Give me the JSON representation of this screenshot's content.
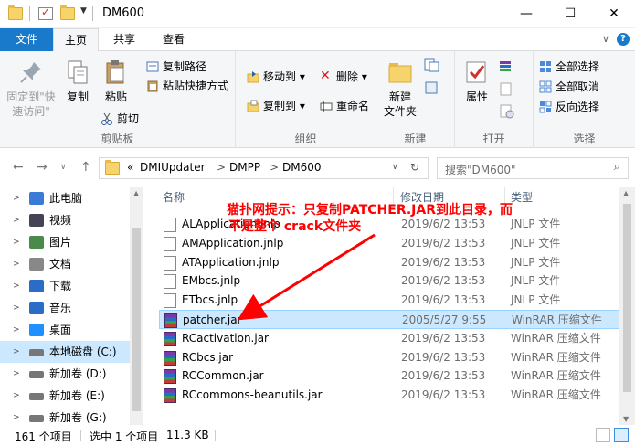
{
  "window": {
    "title": "DM600",
    "minimize": "—",
    "maximize": "☐",
    "close": "✕"
  },
  "tabs": {
    "file": "文件",
    "home": "主页",
    "share": "共享",
    "view": "查看",
    "collapse": "∨",
    "help": "?"
  },
  "ribbon": {
    "clipboard": {
      "label": "剪贴板",
      "pin": "固定到\"快速访问\"",
      "copy": "复制",
      "paste": "粘贴",
      "copy_path": "复制路径",
      "paste_shortcut": "粘贴快捷方式",
      "cut": "剪切"
    },
    "organize": {
      "label": "组织",
      "move_to": "移动到",
      "copy_to": "复制到",
      "delete": "删除",
      "rename": "重命名"
    },
    "new": {
      "label": "新建",
      "new_folder": "新建\n文件夹"
    },
    "open": {
      "label": "打开",
      "properties": "属性"
    },
    "select": {
      "label": "选择",
      "select_all": "全部选择",
      "select_none": "全部取消",
      "invert": "反向选择"
    }
  },
  "address": {
    "prefix": "«",
    "path": [
      "DMIUpdater",
      "DMPP",
      "DM600"
    ],
    "search_placeholder": "搜索\"DM600\""
  },
  "nav": {
    "items": [
      {
        "label": "此电脑",
        "icon": "computer-icon"
      },
      {
        "label": "视频",
        "icon": "video-icon"
      },
      {
        "label": "图片",
        "icon": "pictures-icon"
      },
      {
        "label": "文档",
        "icon": "documents-icon"
      },
      {
        "label": "下载",
        "icon": "download-icon"
      },
      {
        "label": "音乐",
        "icon": "music-icon"
      },
      {
        "label": "桌面",
        "icon": "desktop-icon"
      },
      {
        "label": "本地磁盘 (C:)",
        "icon": "drive-icon"
      },
      {
        "label": "新加卷 (D:)",
        "icon": "drive-icon"
      },
      {
        "label": "新加卷 (E:)",
        "icon": "drive-icon"
      },
      {
        "label": "新加卷 (G:)",
        "icon": "drive-icon"
      }
    ]
  },
  "columns": {
    "name": "名称",
    "date": "修改日期",
    "type": "类型"
  },
  "files": [
    {
      "name": "ALApplication.jnlp",
      "date": "2019/6/2 13:53",
      "type": "JNLP 文件",
      "kind": "doc"
    },
    {
      "name": "AMApplication.jnlp",
      "date": "2019/6/2 13:53",
      "type": "JNLP 文件",
      "kind": "doc"
    },
    {
      "name": "ATApplication.jnlp",
      "date": "2019/6/2 13:53",
      "type": "JNLP 文件",
      "kind": "doc"
    },
    {
      "name": "EMbcs.jnlp",
      "date": "2019/6/2 13:53",
      "type": "JNLP 文件",
      "kind": "doc"
    },
    {
      "name": "ETbcs.jnlp",
      "date": "2019/6/2 13:53",
      "type": "JNLP 文件",
      "kind": "doc"
    },
    {
      "name": "patcher.jar",
      "date": "2005/5/27 9:55",
      "type": "WinRAR 压缩文件",
      "kind": "jar"
    },
    {
      "name": "RCactivation.jar",
      "date": "2019/6/2 13:53",
      "type": "WinRAR 压缩文件",
      "kind": "jar"
    },
    {
      "name": "RCbcs.jar",
      "date": "2019/6/2 13:53",
      "type": "WinRAR 压缩文件",
      "kind": "jar"
    },
    {
      "name": "RCCommon.jar",
      "date": "2019/6/2 13:53",
      "type": "WinRAR 压缩文件",
      "kind": "jar"
    },
    {
      "name": "RCcommons-beanutils.jar",
      "date": "2019/6/2 13:53",
      "type": "WinRAR 压缩文件",
      "kind": "jar"
    }
  ],
  "status": {
    "count": "161 个项目",
    "selected": "选中 1 个项目",
    "size": "11.3 KB"
  },
  "annotation": {
    "line1": "猫扑网提示：只复制PATCHER.JAR到此目录，而",
    "line2": "不是整个 crack文件夹",
    "color": "#ff0000"
  }
}
